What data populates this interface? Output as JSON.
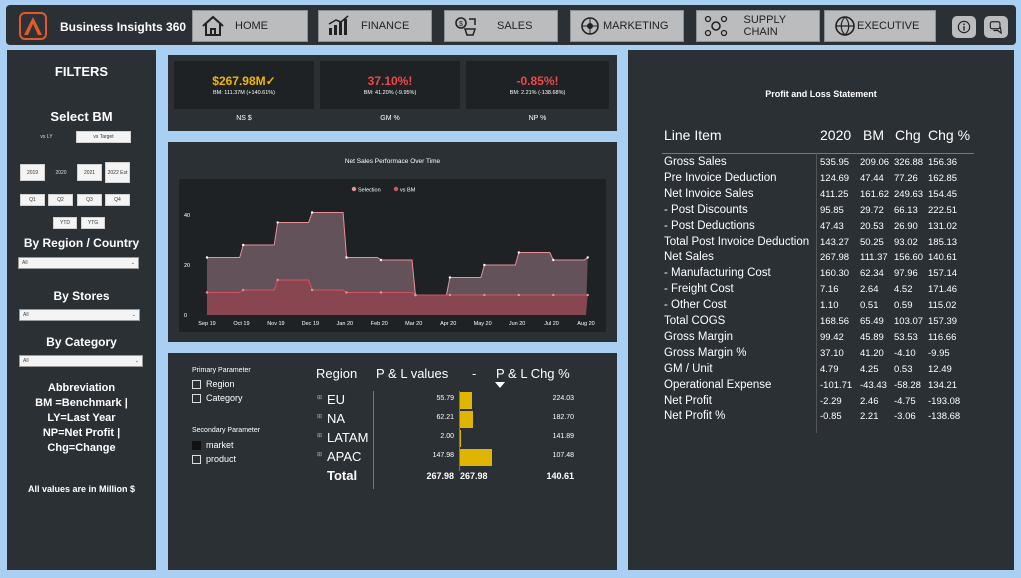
{
  "app": {
    "title": "Business Insights 360"
  },
  "nav": [
    {
      "label": "HOME",
      "icon": "home-icon"
    },
    {
      "label": "FINANCE",
      "icon": "finance-chart-icon"
    },
    {
      "label": "SALES",
      "icon": "sales-icon"
    },
    {
      "label": "MARKETING",
      "icon": "marketing-icon"
    },
    {
      "label": "SUPPLY CHAIN",
      "icon": "supply-chain-icon"
    },
    {
      "label": "EXECUTIVE",
      "icon": "executive-icon"
    }
  ],
  "filters": {
    "title": "FILTERS",
    "select_bm": "Select BM",
    "bm_options": [
      "vs LY",
      "vs Target"
    ],
    "years": [
      "2019",
      "2020",
      "2021",
      "2022 Est"
    ],
    "quarters": [
      "Q1",
      "Q2",
      "Q3",
      "Q4"
    ],
    "periods": [
      "YTD",
      "YTG"
    ],
    "region_label": "By Region / Country",
    "region_value": "All",
    "stores_label": "By Stores",
    "stores_value": "All",
    "category_label": "By Category",
    "category_value": "All",
    "abbrev_title": "Abbreviation",
    "abbrev_lines": [
      "BM =Benchmark |",
      "LY=Last Year",
      "NP=Net Profit |",
      "Chg=Change"
    ],
    "note": "All values are in Million $"
  },
  "kpis": [
    {
      "value": "$267.98M✓",
      "sub": "BM: 111.37M (+140.61%)",
      "label": "NS $",
      "color": "#f2b600"
    },
    {
      "value": "37.10%!",
      "sub": "BM: 41.20% (-9.95%)",
      "label": "GM %",
      "color": "#f04848"
    },
    {
      "value": "-0.85%!",
      "sub": "BM: 2.21% (-138.68%)",
      "label": "NP %",
      "color": "#f04848"
    }
  ],
  "chart_data": {
    "type": "area",
    "title": "Net Sales Performace Over Time",
    "legend": [
      "Selection",
      "vs BM"
    ],
    "legend_position": "top",
    "categories": [
      "Sep 19",
      "Oct 19",
      "Nov 19",
      "Dec 19",
      "Jan 20",
      "Feb 20",
      "Mar 20",
      "Apr 20",
      "May 20",
      "Jun 20",
      "Jul 20",
      "Aug 20"
    ],
    "y_ticks": [
      "0",
      "20",
      "40"
    ],
    "ylim": [
      0,
      48
    ],
    "series": [
      {
        "name": "Selection",
        "values": [
          23,
          28,
          37,
          41,
          23,
          22,
          8,
          15,
          20,
          25,
          22,
          23
        ]
      },
      {
        "name": "vs BM",
        "values": [
          9,
          10,
          14,
          10,
          9,
          9,
          8,
          8,
          8,
          8,
          8,
          8
        ]
      }
    ],
    "colors": {
      "selection": "#e8909a",
      "bm": "#d05560",
      "selection_fill": "#6b5860",
      "bm_fill": "#8a4650"
    }
  },
  "params": {
    "primary_title": "Primary Parameter",
    "primary_options": [
      "Region",
      "Category"
    ],
    "secondary_title": "Secondary Parameter",
    "secondary_options": [
      "market",
      "product"
    ]
  },
  "region_table": {
    "headers": [
      "Region",
      "P & L values",
      "-",
      "P & L Chg %"
    ],
    "rows": [
      {
        "name": "EU",
        "value": "55.79",
        "chg": "224.03",
        "bar": 55.79
      },
      {
        "name": "NA",
        "value": "62.21",
        "chg": "182.70",
        "bar": 62.21
      },
      {
        "name": "LATAM",
        "value": "2.00",
        "chg": "141.89",
        "bar": 2.0
      },
      {
        "name": "APAC",
        "value": "147.98",
        "chg": "107.48",
        "bar": 147.98
      }
    ],
    "total": {
      "name": "Total",
      "value": "267.98",
      "value2": "267.98",
      "chg": "140.61"
    }
  },
  "pnl": {
    "title": "Profit and Loss Statement",
    "headers": [
      "Line Item",
      "2020",
      "BM",
      "Chg",
      "Chg %"
    ],
    "rows": [
      [
        "Gross Sales",
        "535.95",
        "209.06",
        "326.88",
        "156.36"
      ],
      [
        "Pre Invoice Deduction",
        "124.69",
        "47.44",
        "77.26",
        "162.85"
      ],
      [
        "Net Invoice Sales",
        "411.25",
        "161.62",
        "249.63",
        "154.45"
      ],
      [
        "- Post Discounts",
        "95.85",
        "29.72",
        "66.13",
        "222.51"
      ],
      [
        "- Post Deductions",
        "47.43",
        "20.53",
        "26.90",
        "131.02"
      ],
      [
        "Total Post Invoice Deduction",
        "143.27",
        "50.25",
        "93.02",
        "185.13"
      ],
      [
        "Net Sales",
        "267.98",
        "111.37",
        "156.60",
        "140.61"
      ],
      [
        "- Manufacturing Cost",
        "160.30",
        "62.34",
        "97.96",
        "157.14"
      ],
      [
        "- Freight Cost",
        "7.16",
        "2.64",
        "4.52",
        "171.46"
      ],
      [
        "- Other Cost",
        "1.10",
        "0.51",
        "0.59",
        "115.02"
      ],
      [
        "Total COGS",
        "168.56",
        "65.49",
        "103.07",
        "157.39"
      ],
      [
        "Gross Margin",
        "99.42",
        "45.89",
        "53.53",
        "116.66"
      ],
      [
        "Gross Margin %",
        "37.10",
        "41.20",
        "-4.10",
        "-9.95"
      ],
      [
        "GM / Unit",
        "4.79",
        "4.25",
        "0.53",
        "12.49"
      ],
      [
        "Operational Expense",
        "-101.71",
        "-43.43",
        "-58.28",
        "134.21"
      ],
      [
        "Net Profit",
        "-2.29",
        "2.46",
        "-4.75",
        "-193.08"
      ],
      [
        "Net Profit %",
        "-0.85",
        "2.21",
        "-3.06",
        "-138.68"
      ]
    ]
  }
}
